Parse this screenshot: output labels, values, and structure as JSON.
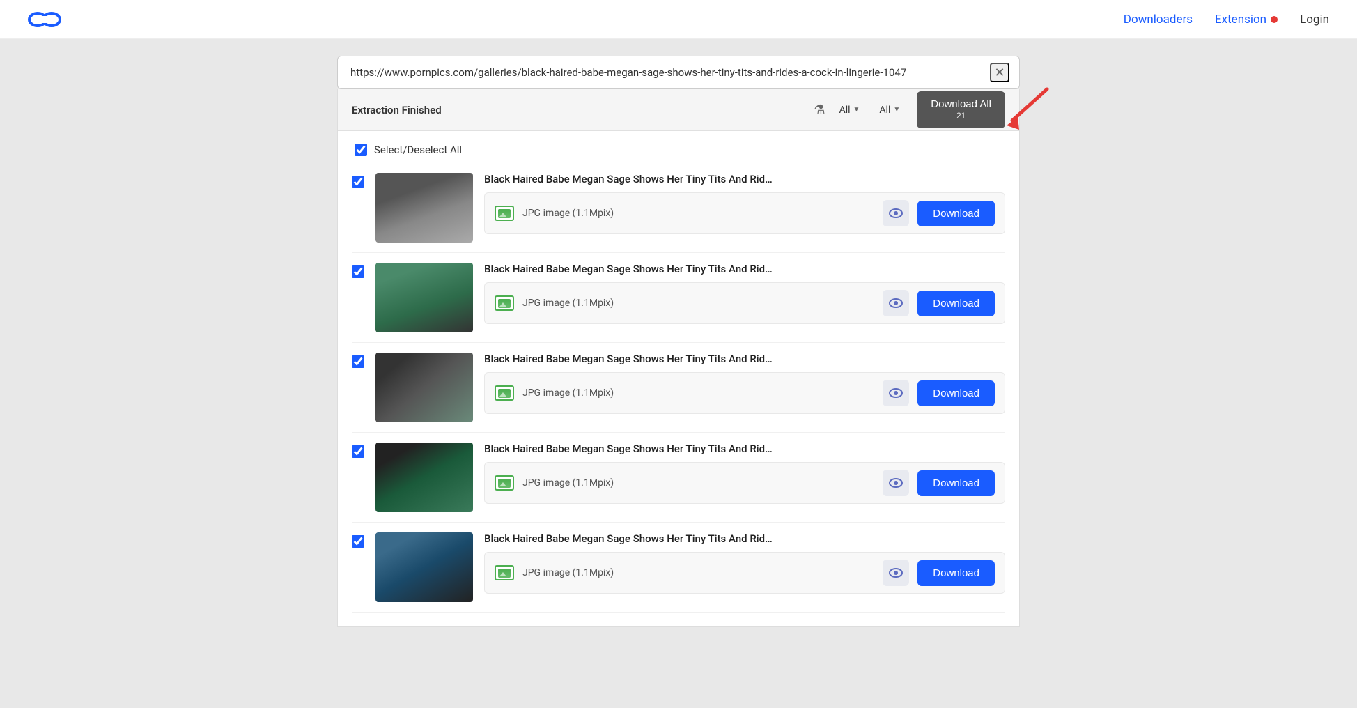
{
  "nav": {
    "logo_aria": "Linkleaner logo",
    "downloaders_label": "Downloaders",
    "extension_label": "Extension",
    "login_label": "Login"
  },
  "url_bar": {
    "url": "https://www.pornpics.com/galleries/black-haired-babe-megan-sage-shows-her-tiny-tits-and-rides-a-cock-in-lingerie-1047",
    "close_aria": "Close"
  },
  "toolbar": {
    "status": "Extraction Finished",
    "filter1_label": "All",
    "filter2_label": "All",
    "download_all_label": "Download All",
    "download_all_count": "21"
  },
  "select_all": {
    "label": "Select/Deselect All"
  },
  "items": [
    {
      "title": "Black Haired Babe Megan Sage Shows Her Tiny Tits And Rid…",
      "meta": "JPG image (1.1Mpix)",
      "checked": true,
      "thumb_class": "thumb-1"
    },
    {
      "title": "Black Haired Babe Megan Sage Shows Her Tiny Tits And Rid…",
      "meta": "JPG image (1.1Mpix)",
      "checked": true,
      "thumb_class": "thumb-2"
    },
    {
      "title": "Black Haired Babe Megan Sage Shows Her Tiny Tits And Rid…",
      "meta": "JPG image (1.1Mpix)",
      "checked": true,
      "thumb_class": "thumb-3"
    },
    {
      "title": "Black Haired Babe Megan Sage Shows Her Tiny Tits And Rid…",
      "meta": "JPG image (1.1Mpix)",
      "checked": true,
      "thumb_class": "thumb-4"
    },
    {
      "title": "Black Haired Babe Megan Sage Shows Her Tiny Tits And Rid…",
      "meta": "JPG image (1.1Mpix)",
      "checked": true,
      "thumb_class": "thumb-5"
    }
  ],
  "buttons": {
    "download_label": "Download",
    "preview_aria": "Preview"
  }
}
